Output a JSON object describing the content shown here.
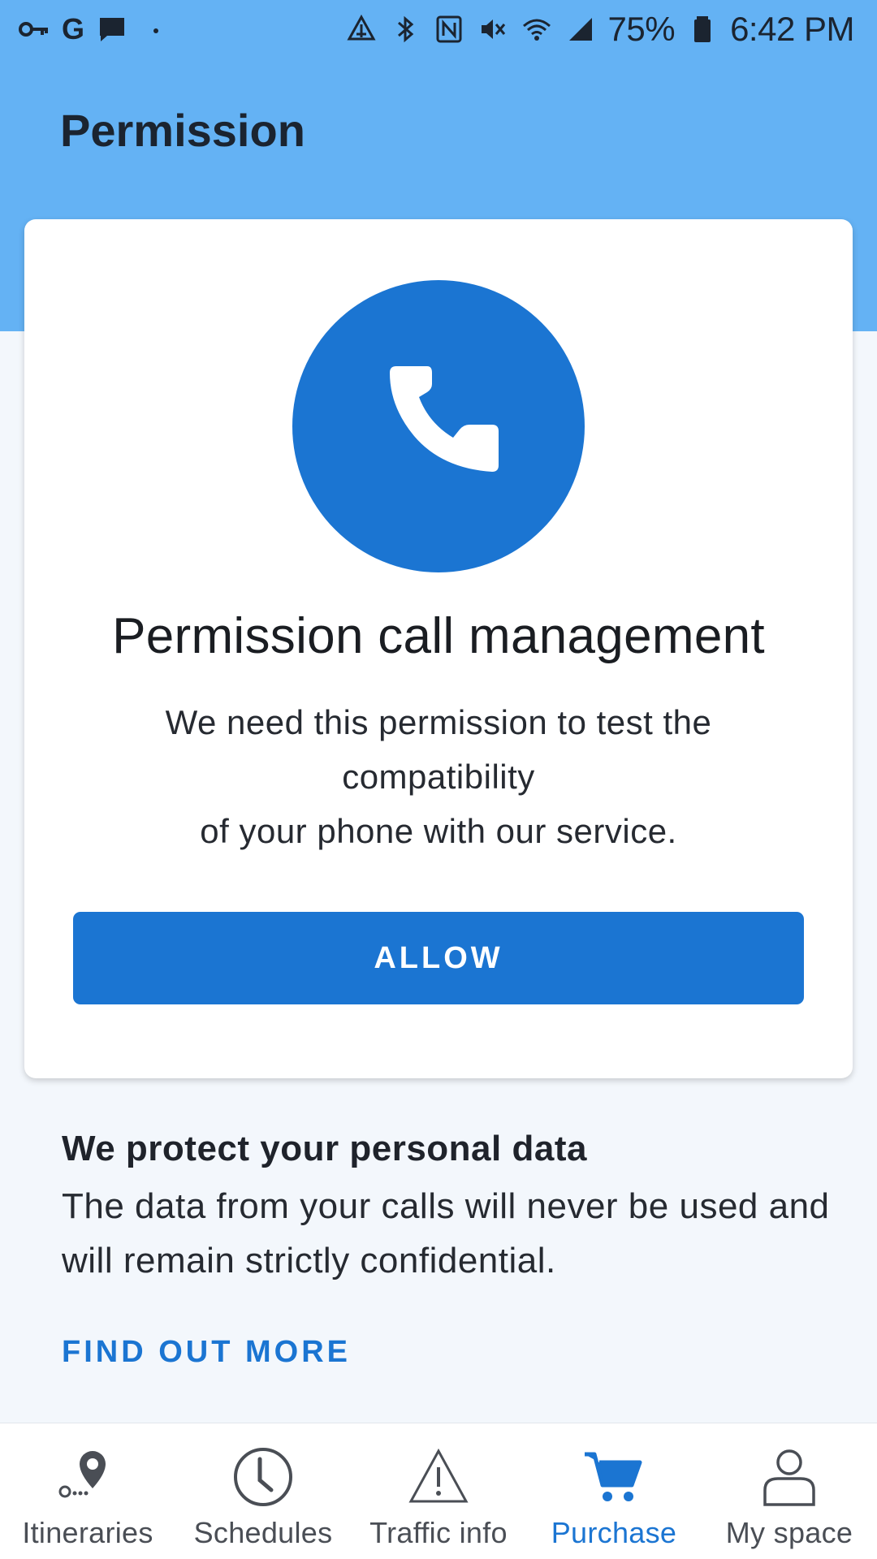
{
  "status_bar": {
    "left_icons": [
      "key-icon",
      "google-icon",
      "message-icon",
      "dot-icon"
    ],
    "right_icons": [
      "data-saver-icon",
      "bluetooth-icon",
      "nfc-icon",
      "mute-icon",
      "wifi-icon",
      "signal-icon",
      "battery-icon"
    ],
    "battery": "75%",
    "time": "6:42 PM"
  },
  "header": {
    "title": "Permission"
  },
  "card": {
    "icon": "phone-icon",
    "title": "Permission call management",
    "description_lines": [
      "We need this permission to test the",
      "compatibility",
      "of your phone with our service."
    ],
    "allow_label": "ALLOW"
  },
  "info": {
    "title": "We protect your personal data",
    "body": "The data from your calls will never be used and will remain strictly confidential.",
    "link": "FIND OUT MORE"
  },
  "bottom_nav": {
    "items": [
      {
        "label": "Itineraries",
        "icon": "location-pin-icon",
        "active": false
      },
      {
        "label": "Schedules",
        "icon": "clock-icon",
        "active": false
      },
      {
        "label": "Traffic info",
        "icon": "warning-icon",
        "active": false
      },
      {
        "label": "Purchase",
        "icon": "cart-icon",
        "active": true
      },
      {
        "label": "My space",
        "icon": "person-icon",
        "active": false
      }
    ]
  },
  "colors": {
    "header": "#64b2f4",
    "accent": "#1b75d2",
    "background": "#f3f7fc"
  }
}
